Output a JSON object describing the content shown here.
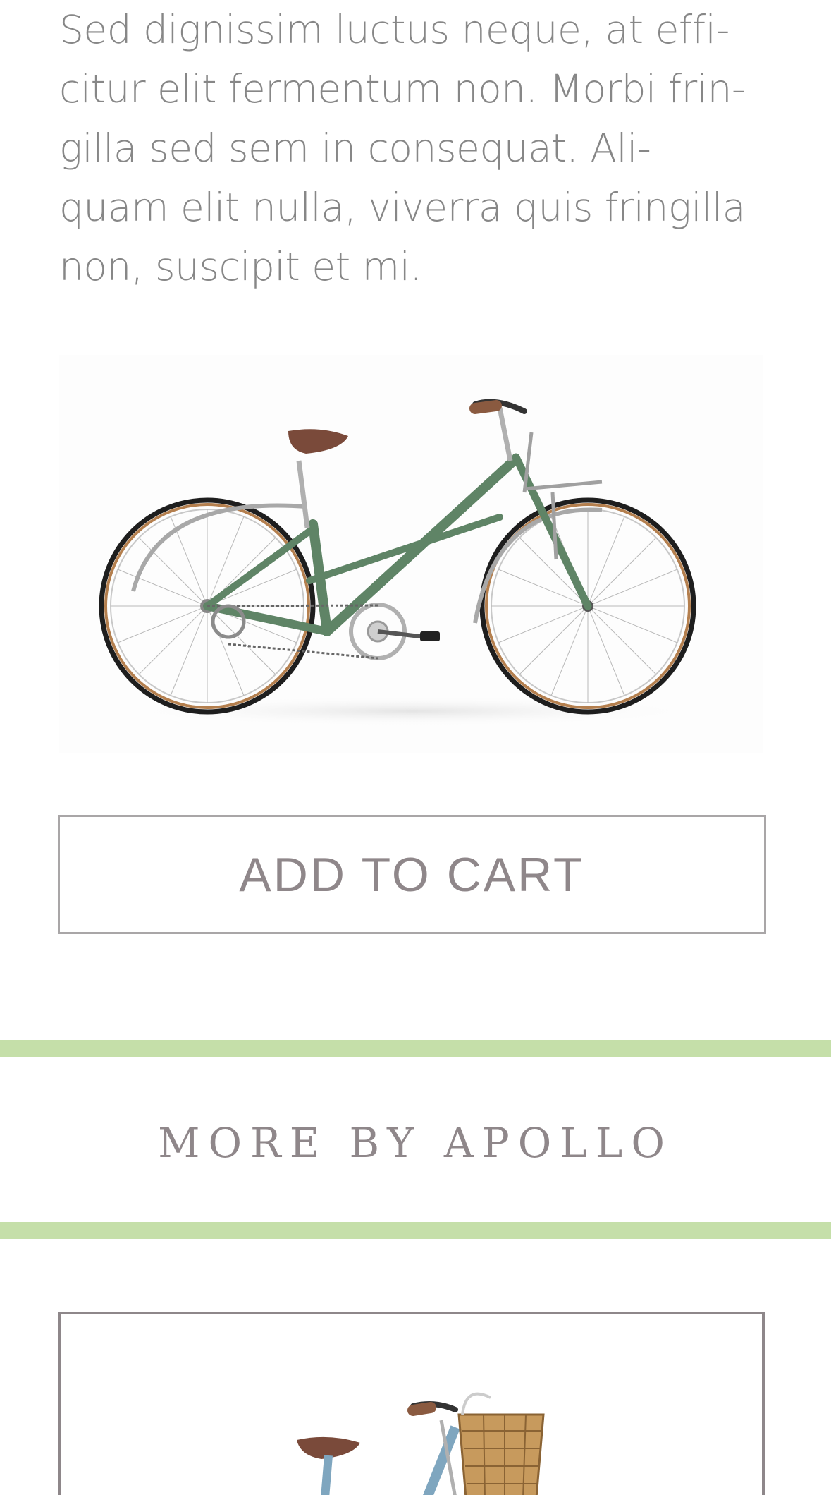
{
  "description": {
    "lines": [
      "Sed dignissim luctus neque, at effi-",
      "citur elit fermentum non. Morbi frin-",
      "gilla sed sem in consequat. Ali-",
      "quam elit nulla, viverra quis fringilla",
      "non, suscipit et mi."
    ]
  },
  "product": {
    "image_icon": "bicycle-image",
    "frame_color": "#5f8466",
    "saddle_color": "#7a4a3a",
    "tire_color": "#1e1e1e",
    "rim_color": "#b47f4e"
  },
  "cart": {
    "button_label": "ADD TO CART"
  },
  "related": {
    "title": "MORE BY APOLLO",
    "accent_color": "#c5dfa9",
    "card_image_icon": "bicycle-with-basket-image",
    "card_frame_color": "#7fa6bf"
  }
}
